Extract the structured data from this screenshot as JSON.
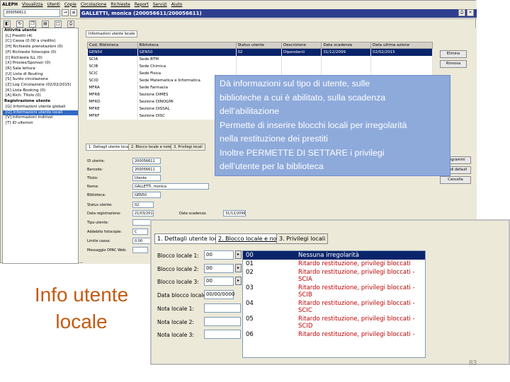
{
  "app": {
    "title": "ALEPH",
    "menu": [
      "Visualizza",
      "Utenti",
      "Copie",
      "Circolazione",
      "Richieste",
      "Report",
      "Servizi",
      "Aiuto"
    ],
    "patron_id_value": "200056611",
    "patron_banner": "GALLETTI, monica (200056611/200056611)"
  },
  "tree": {
    "groups": [
      {
        "label": "Attività utente",
        "items": [
          "[L] Prestiti (4)",
          "[C] Cassa (0.00 a credito)",
          "[H] Richieste prenotazioni (0)",
          "[P] Richieste fotocopie (0)",
          "[I] Richieste ILL (0)",
          "[X] Proxies/Sponsor (0)",
          "[R] Sala lettura",
          "[U] Lista di Routing",
          "[S] Sunto circolazione",
          "[Z] Log Circolazione (02/02/2015)",
          "[K] Lista Booking (0)",
          "[A] Rich. Titolo (0)"
        ]
      },
      {
        "label": "Registrazione utente",
        "items": [
          "[G] Informazioni utente globali",
          "[O] Informazioni utente locali",
          "[V] Informazioni indirizzi",
          "[T] ID ulteriori"
        ]
      }
    ],
    "selected_item": "[O] Informazioni utente locali"
  },
  "main": {
    "section_tab": "Informazioni utente locale",
    "columns": [
      "Cod. Biblioteca",
      "Biblioteca",
      "Status utente",
      "Descrizione",
      "Data scadenza",
      "Data ultima azione"
    ],
    "rows": [
      [
        "GEN50",
        "GEN50",
        "02",
        "Dipendenti",
        "31/12/2099",
        "02/02/2015"
      ],
      [
        "SCIA",
        "Sede BTM",
        "",
        "",
        "",
        ""
      ],
      [
        "SCIB",
        "Sede Chimica",
        "",
        "",
        "",
        ""
      ],
      [
        "SCIC",
        "Sede Fisica",
        "",
        "",
        "",
        ""
      ],
      [
        "SCID",
        "Sede Matematica e Informatica",
        "",
        "",
        "",
        ""
      ],
      [
        "MFRA",
        "Sede Farmacia",
        "",
        "",
        "",
        ""
      ],
      [
        "MFRB",
        "Sezione DIMES",
        "",
        "",
        "",
        ""
      ],
      [
        "MFRD",
        "Sezione DINOGMI",
        "",
        "",
        "",
        ""
      ],
      [
        "MFRE",
        "Sezione DISSAL",
        "",
        "",
        "",
        ""
      ],
      [
        "MFRF",
        "Sezione DISC",
        "",
        "",
        "",
        ""
      ]
    ],
    "buttons": {
      "delete": "Elimina",
      "renew": "Rinnova",
      "programs": "Programmi",
      "defaults": "Ini. di default",
      "cancel": "Cancella"
    },
    "form_tabs": [
      "1. Dettagli utente locale",
      "2. Blocco locale e note",
      "3. Privilegi locali"
    ],
    "form": {
      "id_label": "ID utente:",
      "id_value": "200056611",
      "barcode_label": "Barcode:",
      "barcode_value": "200056611",
      "title_label": "Titolo:",
      "title_value": "Utente",
      "name_label": "Nome:",
      "name_value": "GALLETTI, monica",
      "library_label": "Biblioteca:",
      "library_value": "GEN50",
      "status_label": "Status utente:",
      "status_value": "02",
      "reg_date_label": "Data registrazione:",
      "reg_date_value": "21/03/2012",
      "exp_date_label": "Data scadenza:",
      "exp_date_value": "31/12/2099",
      "type_label": "Tipo utente:",
      "type_value": "",
      "photocopy_label": "Addebito fotocopie:",
      "photocopy_value": "C",
      "cash_limit_label": "Limite cassa:",
      "cash_limit_value": "0.00",
      "opac_msg_label": "Messaggio OPAC Web:",
      "opac_msg_value": ""
    }
  },
  "callout": {
    "lines": [
      "Dà informazioni sul tipo di utente, sulle",
      "biblioteche a cui è abilitato, sulla scadenza",
      "dell’abilitazione",
      "Permette di inserire blocchi locali per irregolarità",
      "nella restituzione dei prestiti",
      "Inoltre PERMETTE DI SETTARE i privilegi",
      "dell’utente per la biblioteca"
    ]
  },
  "slide_title": {
    "line1": "Info utente",
    "line2": "locale"
  },
  "zoom": {
    "tabs": [
      "1. Dettagli utente locale",
      "2. Blocco locale e note",
      "3. Privilegi locali"
    ],
    "fields": [
      {
        "label": "Blocco locale 1:",
        "value": "00"
      },
      {
        "label": "Blocco locale 2:",
        "value": "00"
      },
      {
        "label": "Blocco locale 3:",
        "value": "00"
      },
      {
        "label": "Data blocco locale:",
        "value": "00/00/0000"
      },
      {
        "label": "Nota locale 1:",
        "value": ""
      },
      {
        "label": "Nota locale 2:",
        "value": ""
      },
      {
        "label": "Nota locale 3:",
        "value": ""
      }
    ],
    "options": [
      {
        "code": "00",
        "desc": "Nessuna irregolarità",
        "sub": ""
      },
      {
        "code": "01",
        "desc": "Ritardo restituzione, privilegi bloccati",
        "sub": ""
      },
      {
        "code": "02",
        "desc": "Ritardo restituzione, privilegi bloccati -",
        "sub": "SCIA"
      },
      {
        "code": "03",
        "desc": "Ritardo restituzione, privilegi bloccati -",
        "sub": "SCIB"
      },
      {
        "code": "04",
        "desc": "Ritardo restituzione, privilegi bloccati -",
        "sub": "SCIC"
      },
      {
        "code": "05",
        "desc": "Ritardo restituzione, privilegi bloccati -",
        "sub": "SCID"
      },
      {
        "code": "06",
        "desc": "Ritardo restituzione, privilegi bloccati -",
        "sub": ""
      }
    ]
  },
  "page_number": "83"
}
